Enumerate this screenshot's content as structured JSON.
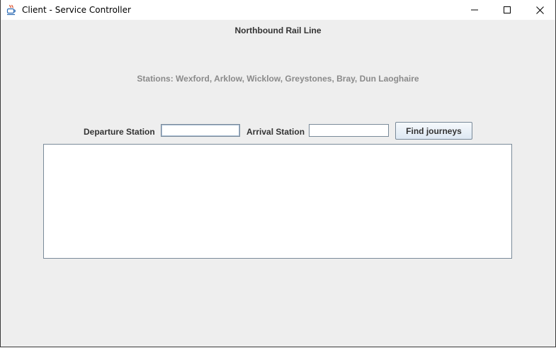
{
  "window": {
    "title": "Client - Service Controller",
    "app_icon": "java-cup-icon",
    "controls": [
      "minimize-icon",
      "maximize-icon",
      "close-icon"
    ]
  },
  "main": {
    "heading": "Northbound Rail Line",
    "stations_text": "Stations: Wexford, Arklow, Wicklow, Greystones, Bray, Dun Laoghaire"
  },
  "form": {
    "departure_label": "Departure Station",
    "departure_value": "",
    "arrival_label": "Arrival Station",
    "arrival_value": "",
    "find_button_label": "Find journeys"
  },
  "results": {
    "text": ""
  },
  "colors": {
    "background": "#eeeeee",
    "stations_text": "#8a8a8a",
    "border": "#7a8a99"
  }
}
